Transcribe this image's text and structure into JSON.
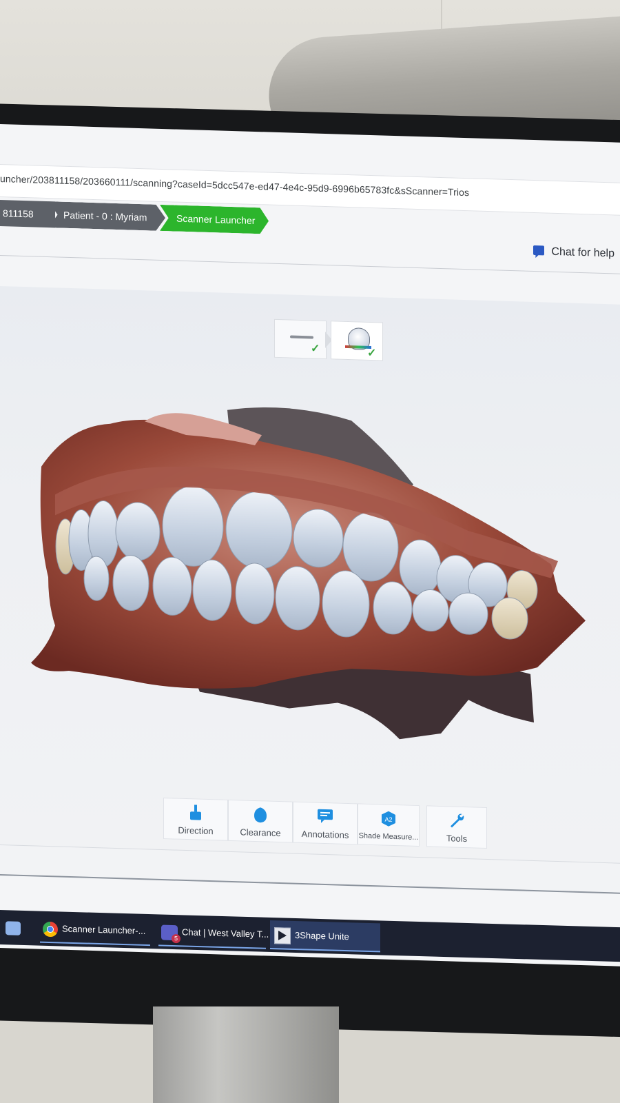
{
  "browser": {
    "url": "uncher/203811158/203660111/scanning?caseId=5dcc547e-ed47-4e4c-95d9-6996b65783fc&sScanner=Trios"
  },
  "breadcrumb": {
    "items": [
      {
        "label": "811158"
      },
      {
        "label": "Patient - 0 : Myriam"
      },
      {
        "label": "Scanner Launcher",
        "active": true
      }
    ]
  },
  "header": {
    "chat_label": "Chat for help"
  },
  "toolbar": {
    "items": [
      {
        "label": "Direction",
        "icon": "direction-icon"
      },
      {
        "label": "Clearance",
        "icon": "clearance-icon"
      },
      {
        "label": "Annotations",
        "icon": "annotations-icon"
      },
      {
        "label": "Shade Measure...",
        "icon": "shade-measure-icon",
        "badge": "A2"
      },
      {
        "label": "Tools",
        "icon": "wrench-icon"
      }
    ]
  },
  "stage_toggle": {
    "items": [
      {
        "icon": "preparation-icon",
        "done": true
      },
      {
        "icon": "bite-scan-icon",
        "done": true
      }
    ]
  },
  "taskbar": {
    "items": [
      {
        "label": "Scanner Launcher-...",
        "icon": "chrome-icon"
      },
      {
        "label": "Chat | West Valley T...",
        "icon": "teams-icon",
        "badge": "5"
      },
      {
        "label": "3Shape Unite",
        "icon": "unite-icon",
        "active": true
      }
    ]
  },
  "colors": {
    "accent_green": "#2cb52c",
    "breadcrumb_gray": "#5d6168",
    "chat_blue": "#2b59c3",
    "taskbar": "#1c2130"
  }
}
